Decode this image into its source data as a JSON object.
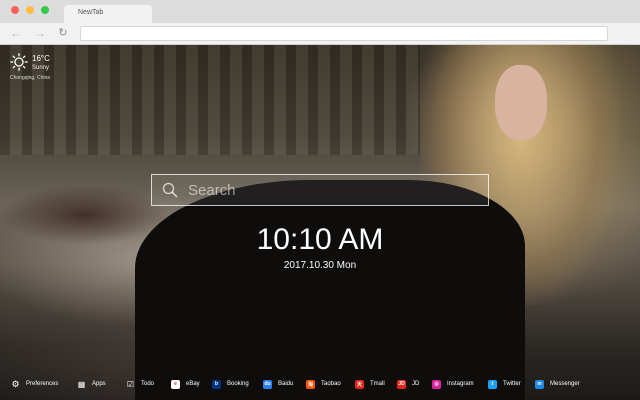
{
  "browser": {
    "tab_title": "NewTab"
  },
  "weather": {
    "icon": "sun-icon",
    "temperature": "16°C",
    "condition": "Sunny",
    "location": "Chongqing, China"
  },
  "search": {
    "placeholder": "Search"
  },
  "clock": {
    "time": "10:10 AM",
    "date": "2017.10.30 Mon"
  },
  "bottom_bar": {
    "preferences": {
      "icon": "gear-icon",
      "label": "Preferences"
    },
    "apps": {
      "icon": "grid-icon",
      "label": "Apps"
    },
    "todo": {
      "icon": "checkbox-icon",
      "label": "Todo"
    },
    "links": [
      {
        "label": "eBay",
        "icon": "ebay-icon",
        "color": "#ffffff",
        "glyph": "e"
      },
      {
        "label": "Booking",
        "icon": "booking-icon",
        "color": "#003580",
        "glyph": "b"
      },
      {
        "label": "Baidu",
        "icon": "baidu-icon",
        "color": "#2a7ff5",
        "glyph": "du"
      },
      {
        "label": "Taobao",
        "icon": "taobao-icon",
        "color": "#ff5000",
        "glyph": "淘"
      },
      {
        "label": "Tmall",
        "icon": "tmall-icon",
        "color": "#e2231a",
        "glyph": "天"
      },
      {
        "label": "JD",
        "icon": "jd-icon",
        "color": "#e1251b",
        "glyph": "JD"
      },
      {
        "label": "Instagram",
        "icon": "instagram-icon",
        "color": "#d6249f",
        "glyph": "◎"
      },
      {
        "label": "Twitter",
        "icon": "twitter-icon",
        "color": "#1da1f2",
        "glyph": "t"
      },
      {
        "label": "Messenger",
        "icon": "messenger-icon",
        "color": "#1e88e5",
        "glyph": "m"
      }
    ]
  }
}
